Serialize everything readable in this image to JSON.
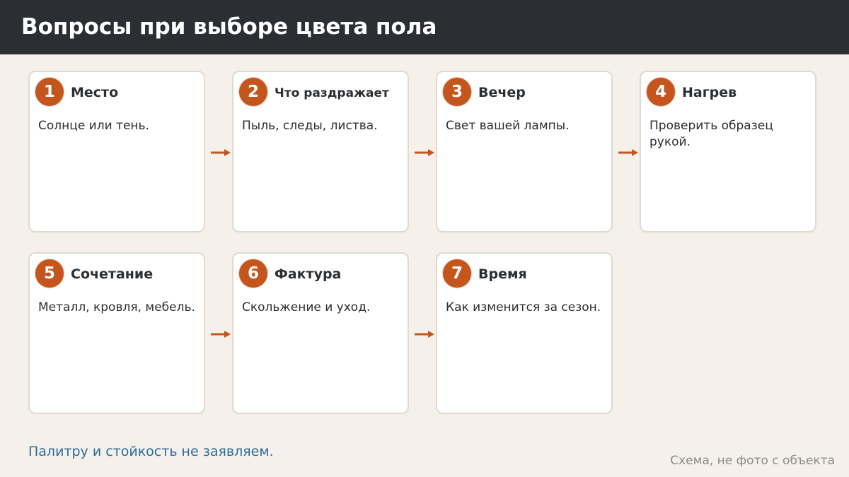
{
  "header": {
    "title": "Вопросы при выборе цвета пола"
  },
  "steps": [
    {
      "number": "1",
      "title": "Место",
      "text": "Солнце или тень."
    },
    {
      "number": "2",
      "title": "Что раздражает",
      "text": "Пыль, следы, листва."
    },
    {
      "number": "3",
      "title": "Вечер",
      "text": "Свет вашей лампы."
    },
    {
      "number": "4",
      "title": "Нагрев",
      "text": "Проверить образец рукой."
    },
    {
      "number": "5",
      "title": "Сочетание",
      "text": "Металл, кровля, мебель."
    },
    {
      "number": "6",
      "title": "Фактура",
      "text": "Скольжение и уход."
    },
    {
      "number": "7",
      "title": "Время",
      "text": "Как изменится за сезон."
    }
  ],
  "footer": {
    "note": "Палитру и стойкость не заявляем.",
    "caption": "Схема, не фото с объекта"
  },
  "colors": {
    "header_bg": "#2b2e33",
    "accent": "#c4551c",
    "page_bg": "#f5f1ea",
    "note_text": "#2d6a99"
  }
}
